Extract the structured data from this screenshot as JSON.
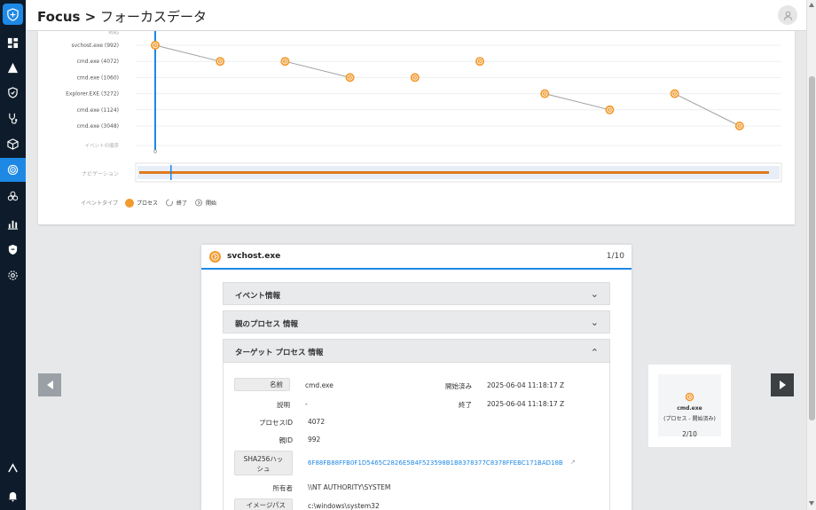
{
  "header": {
    "title_bold": "Focus >",
    "title_rest": " フォーカスデータ"
  },
  "sidebar": {
    "items": [
      {
        "icon": "dashboard-icon",
        "active": false
      },
      {
        "icon": "alert-icon",
        "active": false
      },
      {
        "icon": "shield-icon",
        "active": false
      },
      {
        "icon": "stethoscope-icon",
        "active": false
      },
      {
        "icon": "cube-icon",
        "active": false
      },
      {
        "icon": "focus-icon",
        "active": true
      },
      {
        "icon": "biohazard-icon",
        "active": false
      },
      {
        "icon": "report-icon",
        "active": false
      },
      {
        "icon": "policy-icon",
        "active": false
      },
      {
        "icon": "settings-icon",
        "active": false
      }
    ]
  },
  "timeline": {
    "top_label": "対応",
    "rows": [
      "svchost.exe (992)",
      "cmd.exe (4072)",
      "cmd.exe (1060)",
      "Explorer.EXE (3272)",
      "cmd.exe (1124)",
      "cmd.exe (3048)"
    ],
    "order_label": "イベントの順序",
    "order_tick": "0",
    "navigation_label": "ナビゲーション",
    "legend": {
      "title": "イベントタイプ",
      "process": "プロセス",
      "end": "終了",
      "start": "開始"
    },
    "colors": {
      "event": "#f39a2e",
      "cursor": "#1e88e5",
      "line": "#9e9e9e"
    },
    "events": [
      {
        "row": 0,
        "order": 0
      },
      {
        "row": 1,
        "order": 1
      },
      {
        "row": 1,
        "order": 2
      },
      {
        "row": 2,
        "order": 3
      },
      {
        "row": 2,
        "order": 4
      },
      {
        "row": 1,
        "order": 5
      },
      {
        "row": 3,
        "order": 6
      },
      {
        "row": 4,
        "order": 7
      },
      {
        "row": 3,
        "order": 8
      },
      {
        "row": 5,
        "order": 9
      }
    ],
    "links": [
      [
        0,
        1
      ],
      [
        2,
        3
      ],
      [
        6,
        7
      ],
      [
        8,
        9
      ]
    ]
  },
  "detail": {
    "title": "svchost.exe",
    "count": "1/10",
    "sections": [
      "イベント情報",
      "親のプロセス 情報",
      "ターゲット プロセス 情報"
    ],
    "fields": {
      "name_label": "名前",
      "name_value": "cmd.exe",
      "started_label": "開始済み",
      "started_value": "2025-06-04 11:18:17 Z",
      "desc_label": "説明",
      "desc_value": "-",
      "end_label": "終了",
      "end_value": "2025-06-04 11:18:17 Z",
      "pid_label": "プロセスID",
      "pid_value": "4072",
      "ppid_label": "親ID",
      "ppid_value": "992",
      "sha_label_1": "SHA256ハッ",
      "sha_label_2": "シュ",
      "sha_value": "6F88FB88FFB0F1D5465C2826E5B4F523598B1B8378377C8378FFEBC171BAD18B",
      "owner_label": "所有者",
      "owner_value": "\\\\NT AUTHORITY\\SYSTEM",
      "image_label": "イメージパス",
      "image_value": "c:\\windows\\system32"
    }
  },
  "next": {
    "name": "cmd.exe",
    "sub": "(プロセス - 開始済み)",
    "count": "2/10"
  }
}
